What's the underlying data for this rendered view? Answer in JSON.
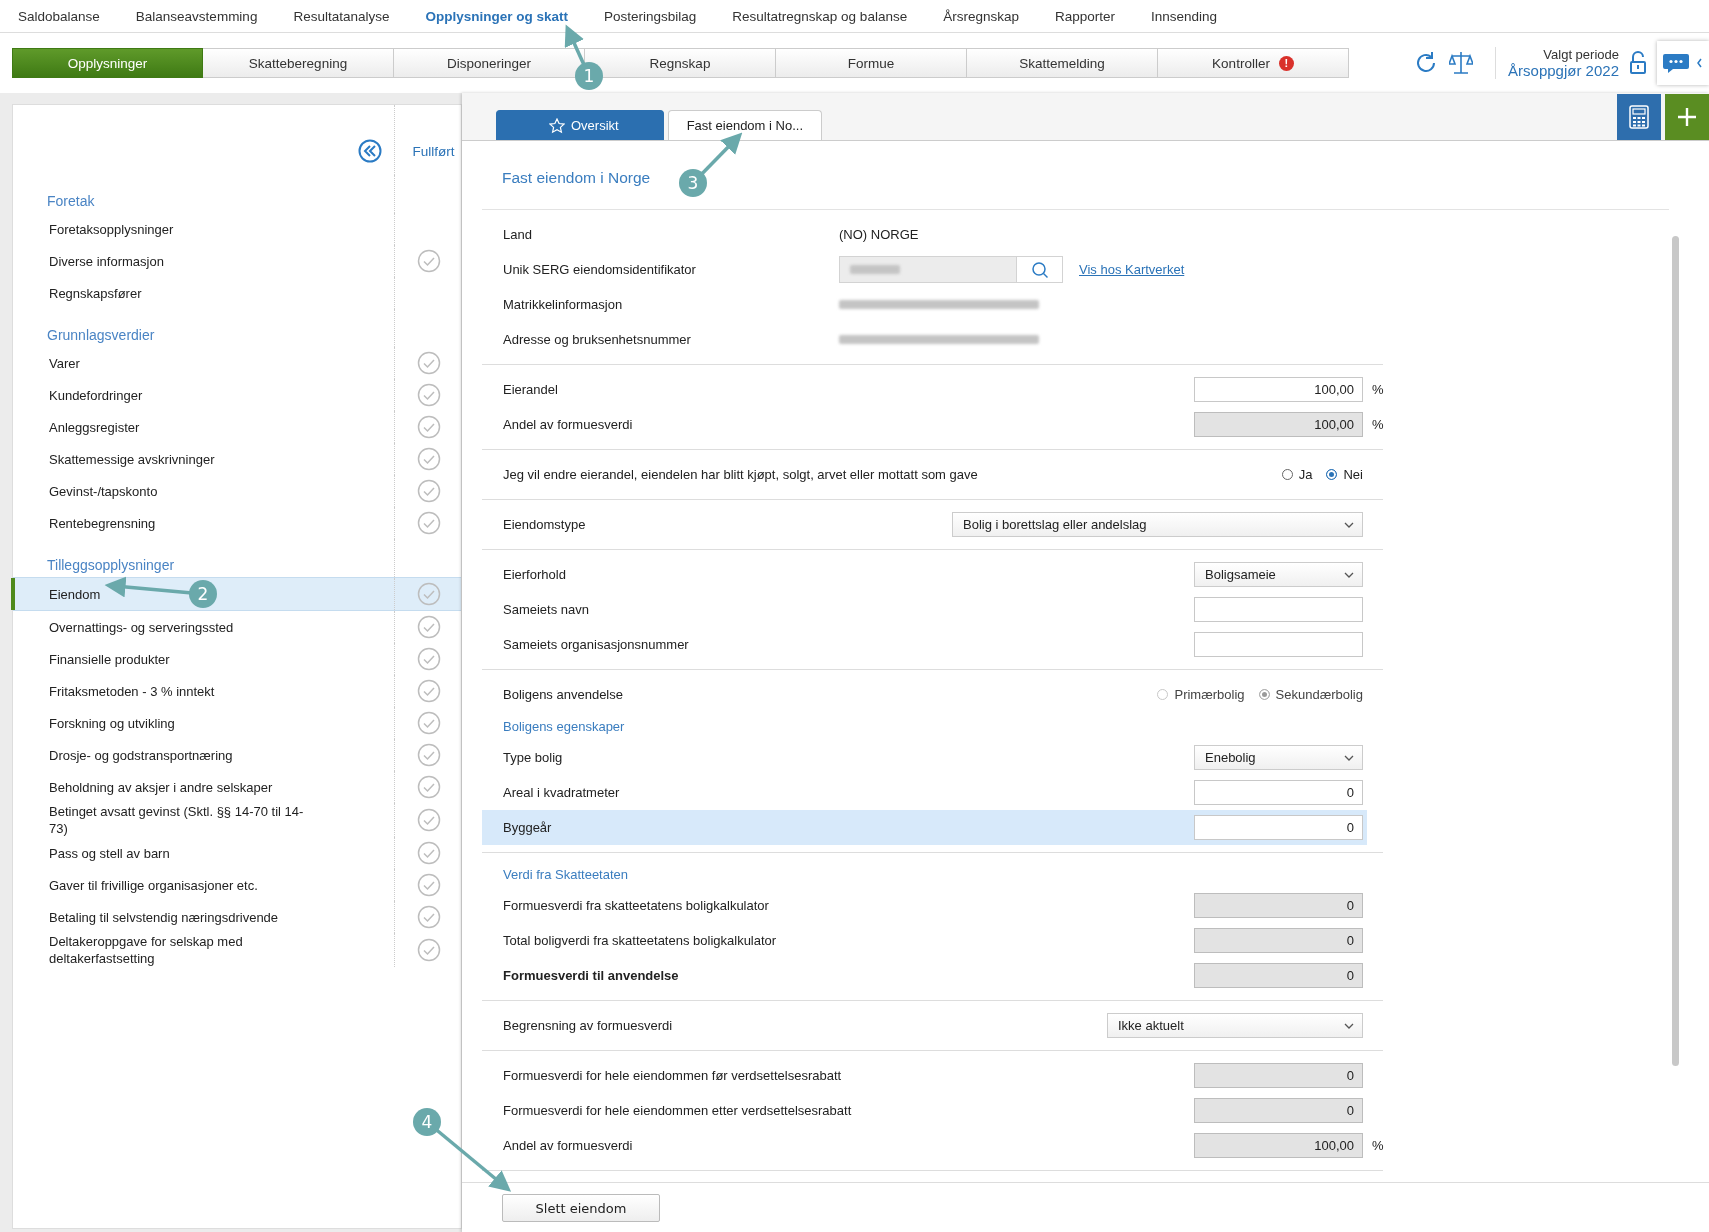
{
  "top_nav": [
    {
      "label": "Saldobalanse",
      "selected": false
    },
    {
      "label": "Balanseavstemming",
      "selected": false
    },
    {
      "label": "Resultatanalyse",
      "selected": false
    },
    {
      "label": "Opplysninger og skatt",
      "selected": true
    },
    {
      "label": "Posteringsbilag",
      "selected": false
    },
    {
      "label": "Resultatregnskap og balanse",
      "selected": false
    },
    {
      "label": "Årsregnskap",
      "selected": false
    },
    {
      "label": "Rapporter",
      "selected": false
    },
    {
      "label": "Innsending",
      "selected": false
    }
  ],
  "sub_tabs": [
    {
      "label": "Opplysninger",
      "selected": true
    },
    {
      "label": "Skatteberegning",
      "selected": false
    },
    {
      "label": "Disponeringer",
      "selected": false
    },
    {
      "label": "Regnskap",
      "selected": false
    },
    {
      "label": "Formue",
      "selected": false
    },
    {
      "label": "Skattemelding",
      "selected": false
    },
    {
      "label": "Kontroller",
      "selected": false,
      "alert_badge": "!"
    }
  ],
  "period": {
    "caption": "Valgt periode",
    "value": "Årsoppgjør 2022"
  },
  "sidebar": {
    "status_header": "Fullført",
    "sections": [
      {
        "title": "Foretak",
        "items": [
          {
            "label": "Foretaksopplysninger",
            "has_status": false,
            "selected": false
          },
          {
            "label": "Diverse informasjon",
            "has_status": true,
            "selected": false
          },
          {
            "label": "Regnskapsfører",
            "has_status": false,
            "selected": false
          }
        ]
      },
      {
        "title": "Grunnlagsverdier",
        "items": [
          {
            "label": "Varer",
            "has_status": true,
            "selected": false
          },
          {
            "label": "Kundefordringer",
            "has_status": true,
            "selected": false
          },
          {
            "label": "Anleggsregister",
            "has_status": true,
            "selected": false
          },
          {
            "label": "Skattemessige avskrivninger",
            "has_status": true,
            "selected": false
          },
          {
            "label": "Gevinst-/tapskonto",
            "has_status": true,
            "selected": false
          },
          {
            "label": "Rentebegrensning",
            "has_status": true,
            "selected": false
          }
        ]
      },
      {
        "title": "Tilleggsopplysninger",
        "items": [
          {
            "label": "Eiendom",
            "has_status": true,
            "selected": true
          },
          {
            "label": "Overnattings- og serveringssted",
            "has_status": true,
            "selected": false
          },
          {
            "label": "Finansielle produkter",
            "has_status": true,
            "selected": false
          },
          {
            "label": "Fritaksmetoden - 3 % inntekt",
            "has_status": true,
            "selected": false
          },
          {
            "label": "Forskning og utvikling",
            "has_status": true,
            "selected": false
          },
          {
            "label": "Drosje- og godstransportnæring",
            "has_status": true,
            "selected": false
          },
          {
            "label": "Beholdning av aksjer i andre selskaper",
            "has_status": true,
            "selected": false
          },
          {
            "label": "Betinget avsatt gevinst (Sktl. §§ 14-70 til 14-73)",
            "has_status": true,
            "selected": false
          },
          {
            "label": "Pass og stell av barn",
            "has_status": true,
            "selected": false
          },
          {
            "label": "Gaver til frivillige organisasjoner etc.",
            "has_status": true,
            "selected": false
          },
          {
            "label": "Betaling til selvstendig næringsdrivende",
            "has_status": true,
            "selected": false
          },
          {
            "label": "Deltakeroppgave for selskap med deltakerfastsetting",
            "has_status": true,
            "selected": false
          }
        ]
      }
    ]
  },
  "doc_tabs": [
    {
      "label": "Oversikt",
      "selected": true
    },
    {
      "label": "Fast eiendom i No...",
      "selected": false
    }
  ],
  "form": {
    "heading": "Fast eiendom i Norge",
    "groups": [
      [
        {
          "kind": "text",
          "label": "Land",
          "value": "(NO) NORGE"
        },
        {
          "kind": "search",
          "label": "Unik SERG eiendomsidentifikator",
          "link": "Vis hos Kartverket"
        },
        {
          "kind": "redacted",
          "label": "Matrikkelinformasjon"
        },
        {
          "kind": "redacted",
          "label": "Adresse og bruksenhetsnummer"
        }
      ],
      [
        {
          "kind": "input",
          "label": "Eierandel",
          "value": "100,00",
          "readonly": false,
          "unit": "%"
        },
        {
          "kind": "input",
          "label": "Andel av formuesverdi",
          "value": "100,00",
          "readonly": true,
          "unit": "%"
        }
      ],
      [
        {
          "kind": "radio",
          "label": "Jeg vil endre eierandel, eiendelen har blitt kjøpt, solgt, arvet eller mottatt som gave",
          "disabled": false,
          "options": [
            {
              "label": "Ja",
              "selected": false
            },
            {
              "label": "Nei",
              "selected": true
            }
          ]
        }
      ],
      [
        {
          "kind": "select",
          "label": "Eiendomstype",
          "value": "Bolig i borettslag eller andelslag"
        }
      ],
      [
        {
          "kind": "select",
          "label": "Eierforhold",
          "value": "Boligsameie"
        },
        {
          "kind": "input",
          "label": "Sameiets navn",
          "readonly": false
        },
        {
          "kind": "input",
          "label": "Sameiets organisasjonsnummer",
          "readonly": false
        }
      ],
      [
        {
          "kind": "radio",
          "label": "Boligens anvendelse",
          "disabled": true,
          "options": [
            {
              "label": "Primærbolig",
              "selected": false
            },
            {
              "label": "Sekundærbolig",
              "selected": true
            }
          ]
        },
        {
          "kind": "subheading",
          "label": "Boligens egenskaper"
        },
        {
          "kind": "select",
          "label": "Type bolig",
          "value": "Enebolig"
        },
        {
          "kind": "input",
          "label": "Areal i kvadratmeter",
          "value": "0",
          "readonly": false
        },
        {
          "kind": "input",
          "label": "Byggeår",
          "value": "0",
          "readonly": false,
          "highlighted": true
        }
      ],
      [
        {
          "kind": "subheading",
          "label": "Verdi fra Skatteetaten"
        },
        {
          "kind": "input",
          "label": "Formuesverdi fra skatteetatens boligkalkulator",
          "value": "0",
          "readonly": true
        },
        {
          "kind": "input",
          "label": "Total boligverdi fra skatteetatens boligkalkulator",
          "value": "0",
          "readonly": true
        },
        {
          "kind": "input",
          "label": "Formuesverdi til anvendelse",
          "value": "0",
          "readonly": true,
          "emphasis": true
        }
      ],
      [
        {
          "kind": "select",
          "label": "Begrensning av formuesverdi",
          "value": "Ikke aktuelt"
        }
      ],
      [
        {
          "kind": "input",
          "label": "Formuesverdi for hele eiendommen før verdsettelsesrabatt",
          "value": "0",
          "readonly": true
        },
        {
          "kind": "input",
          "label": "Formuesverdi for hele eiendommen etter verdsettelsesrabatt",
          "value": "0",
          "readonly": true
        },
        {
          "kind": "input",
          "label": "Andel av formuesverdi",
          "value": "100,00",
          "readonly": true,
          "unit": "%"
        }
      ]
    ]
  },
  "footer_button": "Slett eiendom",
  "callouts": [
    {
      "label": "1"
    },
    {
      "label": "2"
    },
    {
      "label": "3"
    },
    {
      "label": "4"
    }
  ]
}
